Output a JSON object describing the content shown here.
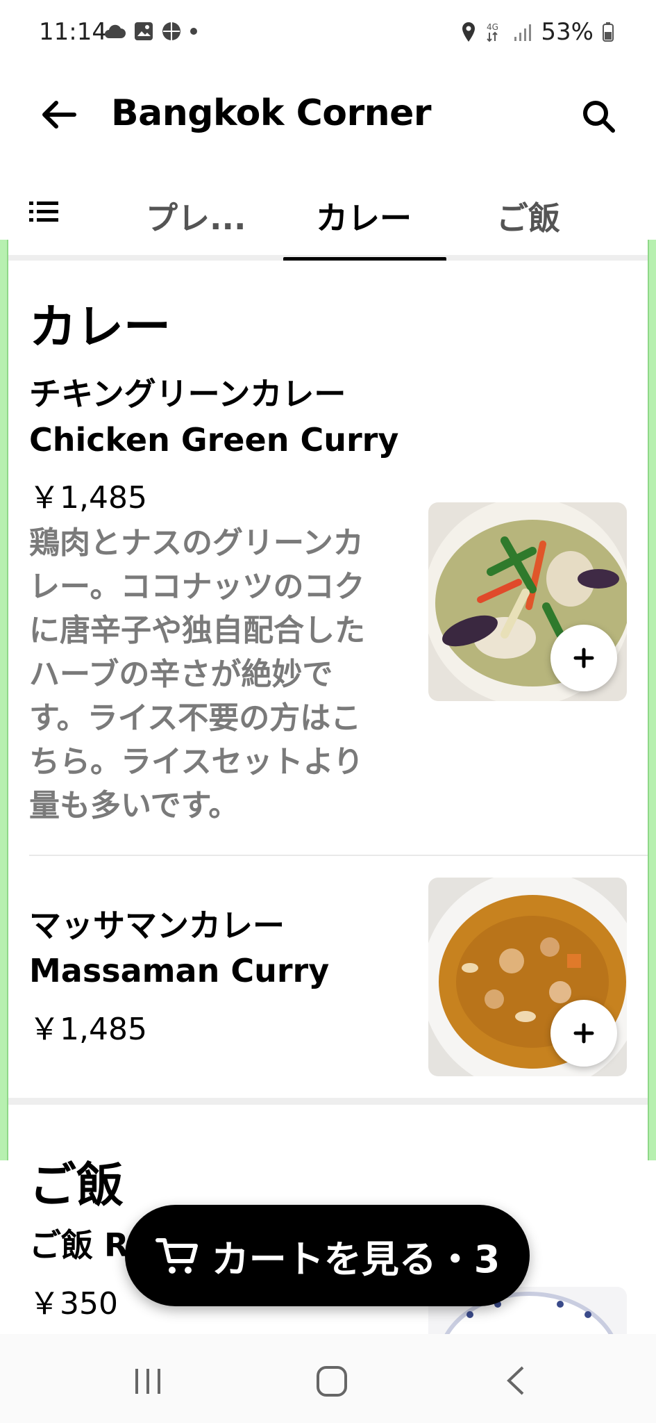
{
  "status_bar": {
    "time": "11:14",
    "battery": "53%",
    "network": "4G"
  },
  "header": {
    "title": "Bangkok Corner"
  },
  "tabs": [
    {
      "label": "プレ..."
    },
    {
      "label": "カレー"
    },
    {
      "label": "ご飯"
    }
  ],
  "sections": {
    "curry": {
      "title": "カレー",
      "items": [
        {
          "name_ja": "チキングリーンカレー",
          "name_en": "Chicken Green Curry",
          "price": "￥1,485",
          "description": "鶏肉とナスのグリーンカレー。ココナッツのコクに唐辛子や独自配合したハーブの辛さが絶妙です。ライス不要の方はこちら。ライスセットより量も多いです。"
        },
        {
          "name_ja": "マッサマンカレー",
          "name_en": "Massaman Curry",
          "price": "￥1,485"
        }
      ]
    },
    "rice": {
      "title": "ご飯",
      "items": [
        {
          "name": "ご飯 R",
          "price": "￥350"
        }
      ]
    }
  },
  "cart": {
    "label": "カートを見る・3"
  },
  "colors": {
    "accent": "#000000",
    "edge_highlight": "#b7f0b0",
    "desc_text": "#7a7a7a"
  }
}
